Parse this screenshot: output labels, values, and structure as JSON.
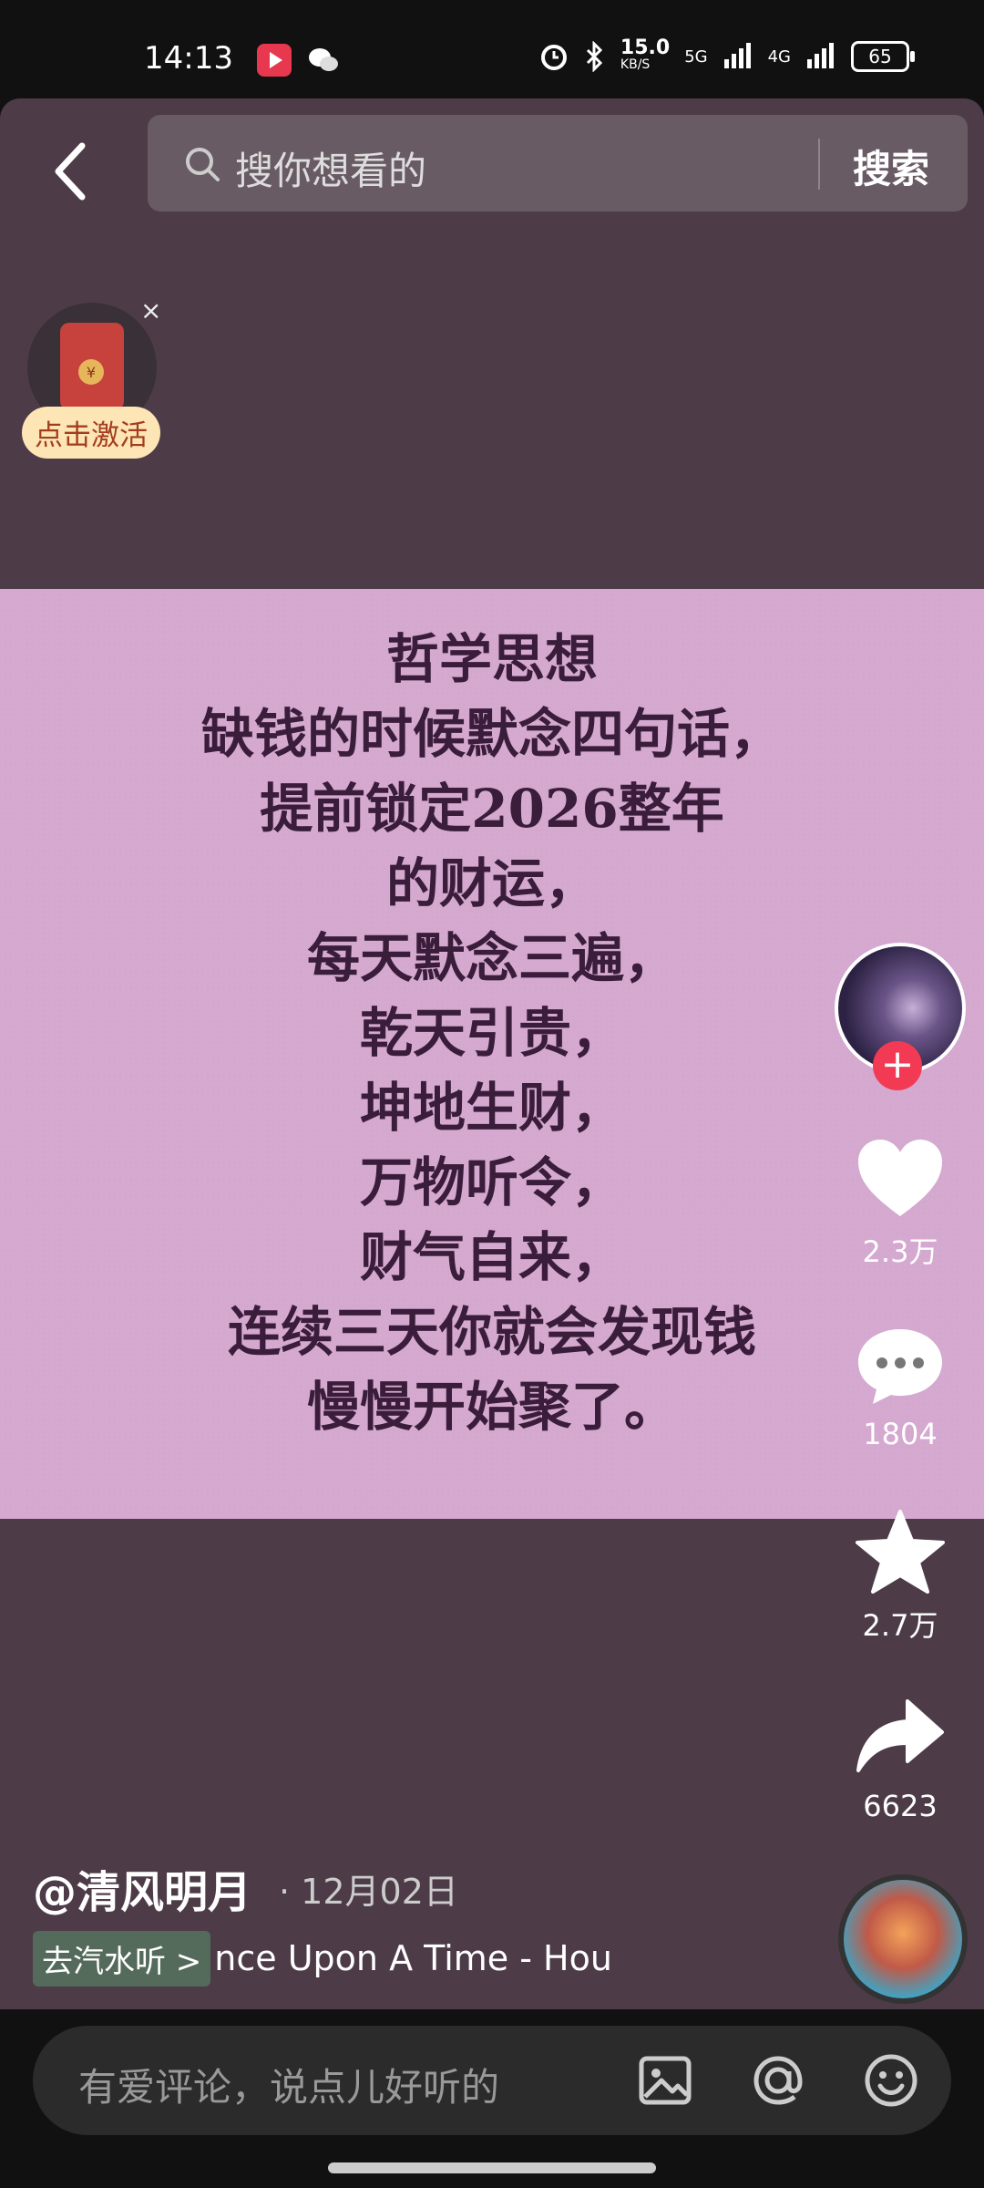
{
  "status_bar": {
    "time": "14:13",
    "speed": "15.0",
    "speed_unit": "KB/S",
    "net1": "5G",
    "net2": "4G",
    "battery": "65"
  },
  "search": {
    "placeholder": "搜你想看的",
    "button": "搜索"
  },
  "promo": {
    "label": "点击激活",
    "close": "×"
  },
  "card": {
    "lines": [
      "哲学思想",
      "缺钱的时候默念四句话，",
      "提前锁定2026整年",
      "的财运，",
      "每天默念三遍，",
      "乾天引贵，",
      "坤地生财，",
      "万物听令，",
      "财气自来，",
      "连续三天你就会发现钱",
      "慢慢开始聚了。"
    ]
  },
  "actions": {
    "follow": "+",
    "likes": "2.3万",
    "comments": "1804",
    "favorites": "2.7万",
    "shares": "6623"
  },
  "post": {
    "author": "@清风明月",
    "date": "· 12月02日",
    "music_tag": "去汽水听 >",
    "music_title": "nce Upon A Time - Hou"
  },
  "comment": {
    "placeholder": "有爱评论，说点儿好听的"
  },
  "colors": {
    "background": "#4d3c47",
    "card": "#d4a8cf",
    "card_text": "#3a1d3a",
    "follow": "#f23a55",
    "promo_label_bg": "#fde5b5"
  }
}
